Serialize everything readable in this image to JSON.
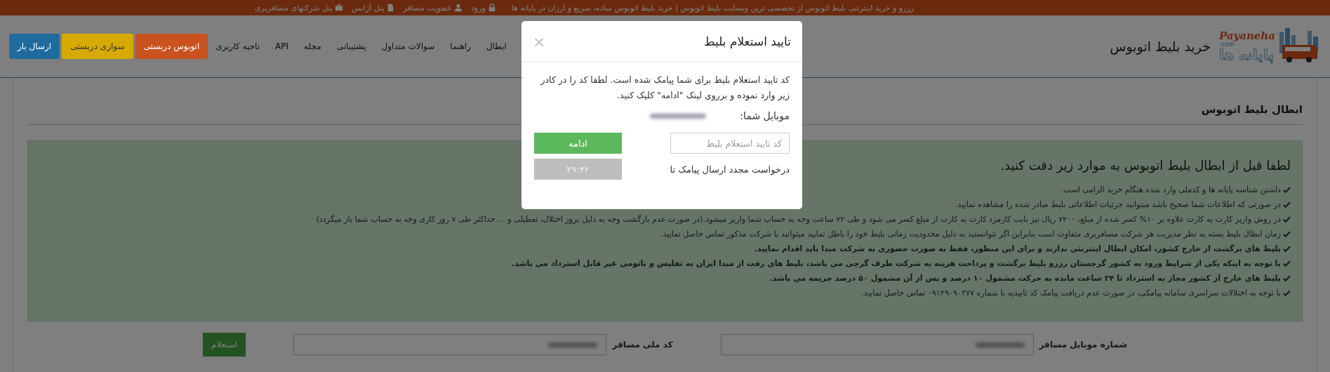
{
  "top_bar": {
    "tagline": "رزرو و خرید اینترنتی بلیط اتوبوس از تخصصی ترین وبسایت بلیط اتوبوس | خرید بلیط اتوبوس ساده، سریع و ارزان در پایانه ها",
    "links": [
      {
        "label": "ورود"
      },
      {
        "label": "عضویت مسافر"
      },
      {
        "label": "پنل آژانس"
      },
      {
        "label": "پنل شرکتهای مسافربری"
      }
    ]
  },
  "header": {
    "logo": {
      "latin": "Payaneha",
      "domain": ".com",
      "persian": "پایانه ها"
    },
    "title": "خرید بلیط اتوبوس",
    "nav": [
      {
        "label": "ابطال",
        "kind": "link"
      },
      {
        "label": "راهنما",
        "kind": "link"
      },
      {
        "label": "سوالات متداول",
        "kind": "link"
      },
      {
        "label": "پشتیبانی",
        "kind": "link"
      },
      {
        "label": "مجله",
        "kind": "link"
      },
      {
        "label": "API",
        "kind": "link"
      },
      {
        "label": "ناحیه کاربری",
        "kind": "link"
      },
      {
        "label": "اتوبوس دربستی",
        "kind": "button",
        "color": "#c9521f"
      },
      {
        "label": "سواری دربستی",
        "kind": "button",
        "color": "#d6aa00"
      },
      {
        "label": "ارسال بار",
        "kind": "button",
        "color": "#1f6b9e"
      }
    ]
  },
  "panel": {
    "legend": "ابطال بلیط اتوبوس",
    "notice": {
      "heading": "لطفا قبل از ابطال بلیط اتوبوس به موارد زیر دقت کنید.",
      "items": [
        {
          "text": "داشتن شناسه پایانه ها و کدملی وارد شده هنگام خرید الزامی است.",
          "bold": false
        },
        {
          "text": "در صورتی که اطلاعات شما صحیح باشد میتوانید جزئیات اطلاعاتی بلیط صادر شده را مشاهده نمایید.",
          "bold": false
        },
        {
          "text": "در روش واریز کارت به کارت علاوه بر ۱۰% کسر شده از مبلغ، ۷۲۰۰ ریال نیز بابت کارمزد کارت به کارت از مبلغ کسر می شود و طی ۷۲ ساعت وجه به حساب شما واریز میشود.(در صورت عدم بازگشت وجه به دلیل بروز اختلال، تعطیلی و ... حداکثر طی ۷ روز کاری وجه به حساب شما باز میگردد)",
          "bold": false
        },
        {
          "text": "زمان ابطال بلیط بسته به نظر مدیریت هر شرکت مسافربری متفاوت است بنابراین اگر نتوانستید به دلیل محدودیت زمانی بلیط خود را باطل نمایید میتوانید با شرکت مذکور تماس حاصل نمایید.",
          "bold": false
        },
        {
          "text": "بلیط های برگشت از خارج کشور، امکان ابطال اینترنتی ندارند و برای این منظور، فقط به صورت حضوری به شرکت مبدا باید اقدام نمایید.",
          "bold": true
        },
        {
          "text": "با توجه به اینکه یکی از شرایط ورود به کشور گرجستان رزرو بلیط برگشت و پرداخت هزینه به شرکت طرف گرجی می باشد، بلیط های رفت از مبدا ایران به تفلیس و باتومی غیر قابل استرداد می باشد.",
          "bold": true
        },
        {
          "text": "بلیط های خارج از کشور مجاز به استرداد تا ۲۴ ساعت مانده به حرکت مشمول ۱۰ درصد و پس از آن مشمول ۵۰ درصد جریمه می باشد.",
          "bold": true
        },
        {
          "text": "با توجه به اختلالات سراسری سامانه پیامکی، در صورت عدم دریافت پیامک کد تاییدیه با شماره ۰۹۱۲۹۰۹۰۳۷۷ تماس حاصل نمایید.",
          "bold": false
        }
      ]
    },
    "form": {
      "fields": [
        {
          "label": "شماره موبایل مسافر"
        },
        {
          "label": "کد ملی مسافر"
        }
      ],
      "button": "استعلام"
    }
  },
  "modal": {
    "title": "تایید استعلام بلیط",
    "close": "×",
    "message": "کد تایید استعلام بلیط برای شما پیامک شده است. لطفا کد را در کادر زیر وارد نموده و برروی لینک \"ادامه\" کلیک کنید.",
    "mobile_label": "موبایل شما:",
    "code_field": {
      "placeholder": "کد تایید استعلام بلیط"
    },
    "continue_button": "ادامه",
    "resend_text": "درخواست مجدد ارسال پیامک تا",
    "timer": {
      "label": "۲۹:۴۲",
      "disabled": true
    }
  }
}
